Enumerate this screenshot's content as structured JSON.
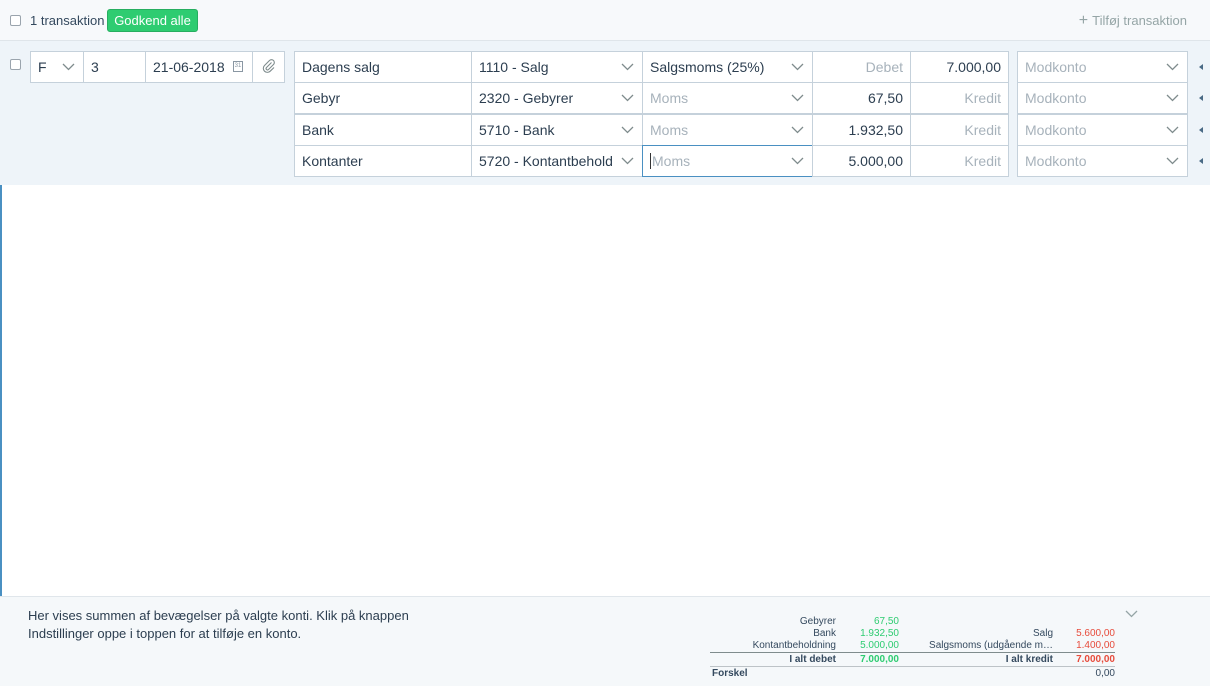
{
  "topbar": {
    "transaction_count": "1 transaktion",
    "approve_all": "Godkend alle",
    "add_transaction_icon": "plus-icon",
    "add_transaction": "Tilføj transaktion"
  },
  "transaction": {
    "type": "F",
    "number": "3",
    "date": "21-06-2018",
    "rows": [
      {
        "text": "Dagens salg",
        "account": "1110 - Salg",
        "vat": "Salgsmoms (25%)",
        "vat_is_placeholder": false,
        "debit": "",
        "debit_placeholder": "Debet",
        "credit": "7.000,00",
        "credit_placeholder": "Kredit",
        "contra_placeholder": "Modkonto"
      },
      {
        "text": "Gebyr",
        "account": "2320 - Gebyrer",
        "vat": "",
        "vat_placeholder": "Moms",
        "debit": "67,50",
        "debit_placeholder": "Debet",
        "credit": "",
        "credit_placeholder": "Kredit",
        "contra_placeholder": "Modkonto"
      },
      {
        "text": "Bank",
        "account": "5710 - Bank",
        "vat": "",
        "vat_placeholder": "Moms",
        "debit": "1.932,50",
        "debit_placeholder": "Debet",
        "credit": "",
        "credit_placeholder": "Kredit",
        "contra_placeholder": "Modkonto"
      },
      {
        "text": "Kontanter",
        "account": "5720 - Kontantbehold",
        "vat": "",
        "vat_placeholder": "Moms",
        "debit": "5.000,00",
        "debit_placeholder": "Debet",
        "credit": "",
        "credit_placeholder": "Kredit",
        "contra_placeholder": "Modkonto"
      }
    ]
  },
  "footer": {
    "info": "Her vises summen af bevægelser på valgte konti. Klik på knappen Indstillinger oppe i toppen for at tilføje en konto.",
    "debit_items": [
      {
        "label": "Gebyrer",
        "value": "67,50"
      },
      {
        "label": "Bank",
        "value": "1.932,50"
      },
      {
        "label": "Kontantbeholdning",
        "value": "5.000,00"
      }
    ],
    "credit_items": [
      {
        "label": "Salg",
        "value": "5.600,00"
      },
      {
        "label": "Salgsmoms (udgående m…",
        "value": "1.400,00"
      }
    ],
    "total_debit_label": "I alt debet",
    "total_debit": "7.000,00",
    "total_credit_label": "I alt kredit",
    "total_credit": "7.000,00",
    "difference_label": "Forskel",
    "difference": "0,00"
  },
  "colors": {
    "approve_green": "#2ecc71",
    "debit_green": "#2ecc71",
    "credit_red": "#e74c3c",
    "row_background": "#eef4f9"
  }
}
